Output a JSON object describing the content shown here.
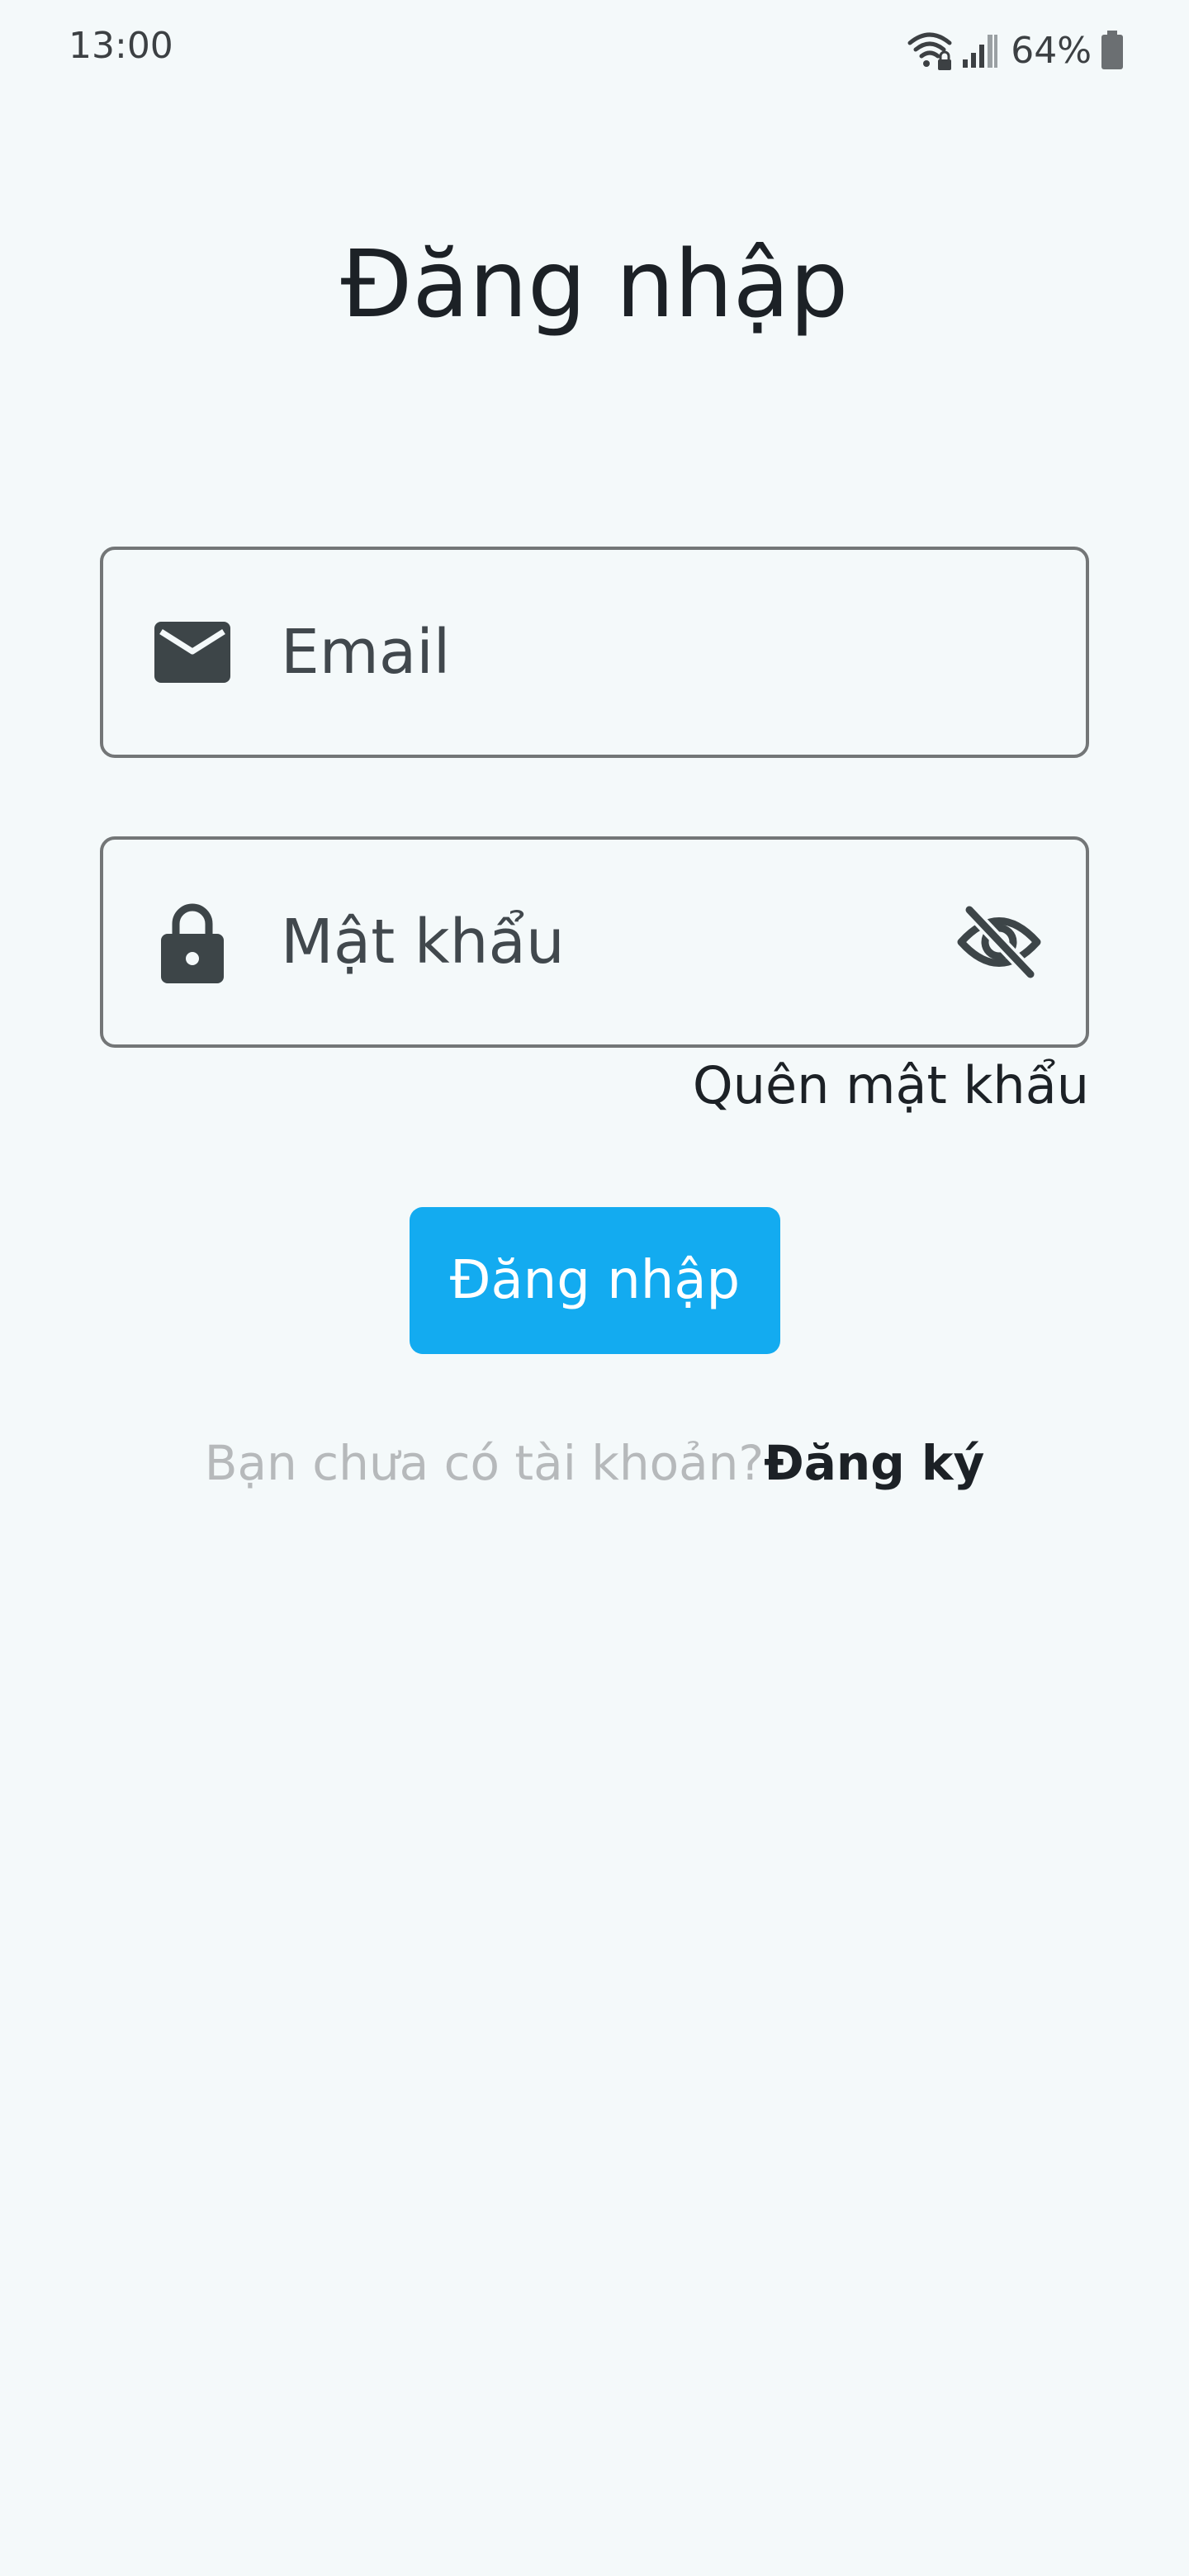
{
  "status_bar": {
    "time": "13:00",
    "battery": "64%",
    "icons": [
      "wifi-lock-icon",
      "signal-icon",
      "battery-icon"
    ]
  },
  "title": "Đăng nhập",
  "email_field": {
    "placeholder": "Email",
    "value": "",
    "icon": "mail-icon"
  },
  "password_field": {
    "placeholder": "Mật khẩu",
    "value": "",
    "icon": "lock-icon",
    "toggle_icon": "visibility-off-icon"
  },
  "forgot_password": "Quên mật khẩu",
  "login_button": "Đăng nhập",
  "signup": {
    "prompt": "Bạn chưa có tài khoản?",
    "link": "Đăng ký"
  },
  "colors": {
    "background": "#f4f9fa",
    "primary": "#13abf0",
    "border": "#737677",
    "icon": "#3d4548",
    "muted_text": "#b6b9bb"
  }
}
